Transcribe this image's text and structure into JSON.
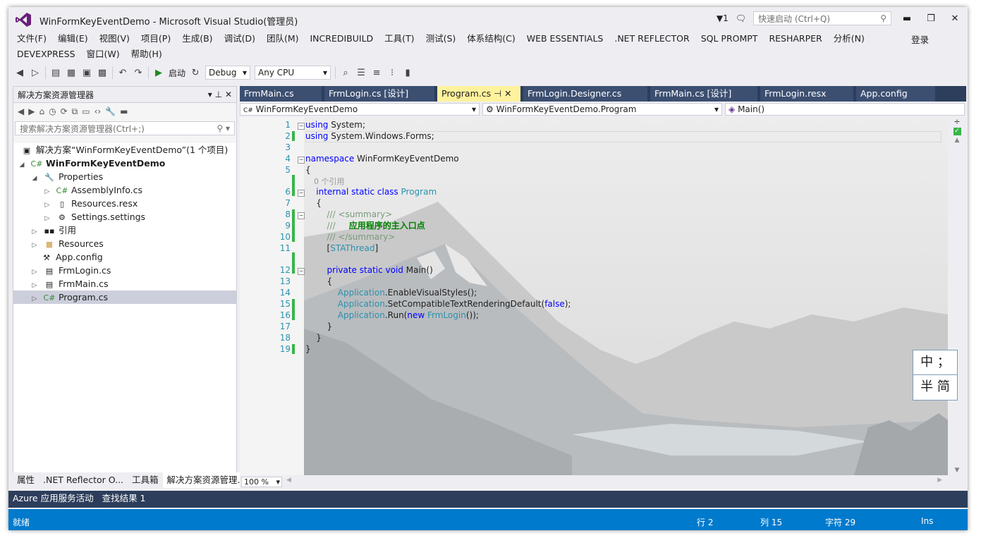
{
  "window": {
    "title": "WinFormKeyEventDemo - Microsoft Visual Studio(管理员)",
    "notifications": "▼1",
    "quick_launch_placeholder": "快速启动 (Ctrl+Q)",
    "login": "登录"
  },
  "menu": [
    "文件(F)",
    "编辑(E)",
    "视图(V)",
    "项目(P)",
    "生成(B)",
    "调试(D)",
    "团队(M)",
    "INCREDIBUILD",
    "工具(T)",
    "测试(S)",
    "体系结构(C)",
    "WEB ESSENTIALS",
    ".NET REFLECTOR",
    "SQL PROMPT",
    "RESHARPER",
    "分析(N)",
    "DEVEXPRESS",
    "窗口(W)",
    "帮助(H)"
  ],
  "toolbar": {
    "start_label": "启动",
    "config": "Debug",
    "platform": "Any CPU"
  },
  "solution_explorer": {
    "title": "解决方案资源管理器",
    "search_placeholder": "搜索解决方案资源管理器(Ctrl+;)",
    "solution": "解决方案“WinFormKeyEventDemo”(1 个项目)",
    "project": "WinFormKeyEventDemo",
    "items": {
      "properties": "Properties",
      "assemblyinfo": "AssemblyInfo.cs",
      "resources_resx": "Resources.resx",
      "settings": "Settings.settings",
      "references": "引用",
      "resources": "Resources",
      "appconfig": "App.config",
      "frmlogin": "FrmLogin.cs",
      "frmmain": "FrmMain.cs",
      "program": "Program.cs"
    }
  },
  "left_tabs": [
    "属性",
    ".NET Reflector O...",
    "工具箱",
    "解决方案资源管理..."
  ],
  "doc_tabs": [
    "FrmMain.cs",
    "FrmLogin.cs [设计]",
    "Program.cs",
    "FrmLogin.Designer.cs",
    "FrmMain.cs [设计]",
    "FrmLogin.resx",
    "App.config"
  ],
  "navbar": {
    "project": "WinFormKeyEventDemo",
    "class": "WinFormKeyEventDemo.Program",
    "member": "Main()"
  },
  "code": {
    "line_numbers": [
      "1",
      "2",
      "3",
      "4",
      "5",
      "6",
      "7",
      "8",
      "9",
      "10",
      "11",
      "12",
      "13",
      "14",
      "15",
      "16",
      "17",
      "18",
      "19"
    ],
    "ref_hint": "0 个引用",
    "summary_text": "应用程序的主入口点"
  },
  "zoom": "100 %",
  "ime": {
    "row1": "中 ；",
    "row2": "半 简"
  },
  "bottom_tabs": [
    "Azure 应用服务活动",
    "查找结果 1"
  ],
  "status": {
    "left": "就绪",
    "line": "行 2",
    "col": "列 15",
    "char": "字符 29",
    "ins": "Ins"
  },
  "colors": {
    "accent": "#007acc",
    "tab_bar": "#2d3e5c",
    "active_tab": "#fff29d",
    "change_mark": "#39b54a"
  }
}
